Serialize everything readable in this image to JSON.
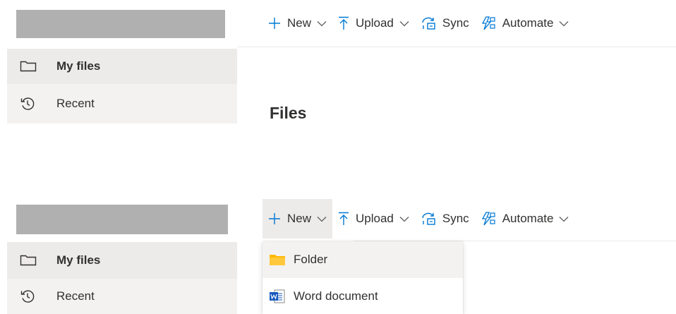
{
  "panels": [
    {
      "sidebar": {
        "items": [
          {
            "label": "My files",
            "icon": "folder-icon",
            "active": true
          },
          {
            "label": "Recent",
            "icon": "history-icon",
            "active": false
          }
        ]
      },
      "commandbar": {
        "new_label": "New",
        "upload_label": "Upload",
        "sync_label": "Sync",
        "automate_label": "Automate"
      },
      "page_title": "Files"
    },
    {
      "sidebar": {
        "items": [
          {
            "label": "My files",
            "icon": "folder-icon",
            "active": true
          },
          {
            "label": "Recent",
            "icon": "history-icon",
            "active": false
          }
        ]
      },
      "commandbar": {
        "new_label": "New",
        "upload_label": "Upload",
        "sync_label": "Sync",
        "automate_label": "Automate"
      },
      "new_menu": {
        "items": [
          {
            "label": "Folder",
            "icon": "folder-yellow-icon"
          },
          {
            "label": "Word document",
            "icon": "word-icon"
          }
        ]
      }
    }
  ],
  "colors": {
    "accent": "#0078d4",
    "active_bg": "#edebe9",
    "sidebar_bg": "#f3f2f1",
    "redacted": "#b0b0b0",
    "folder_yellow": "#ffb900",
    "word_blue": "#185abd"
  }
}
